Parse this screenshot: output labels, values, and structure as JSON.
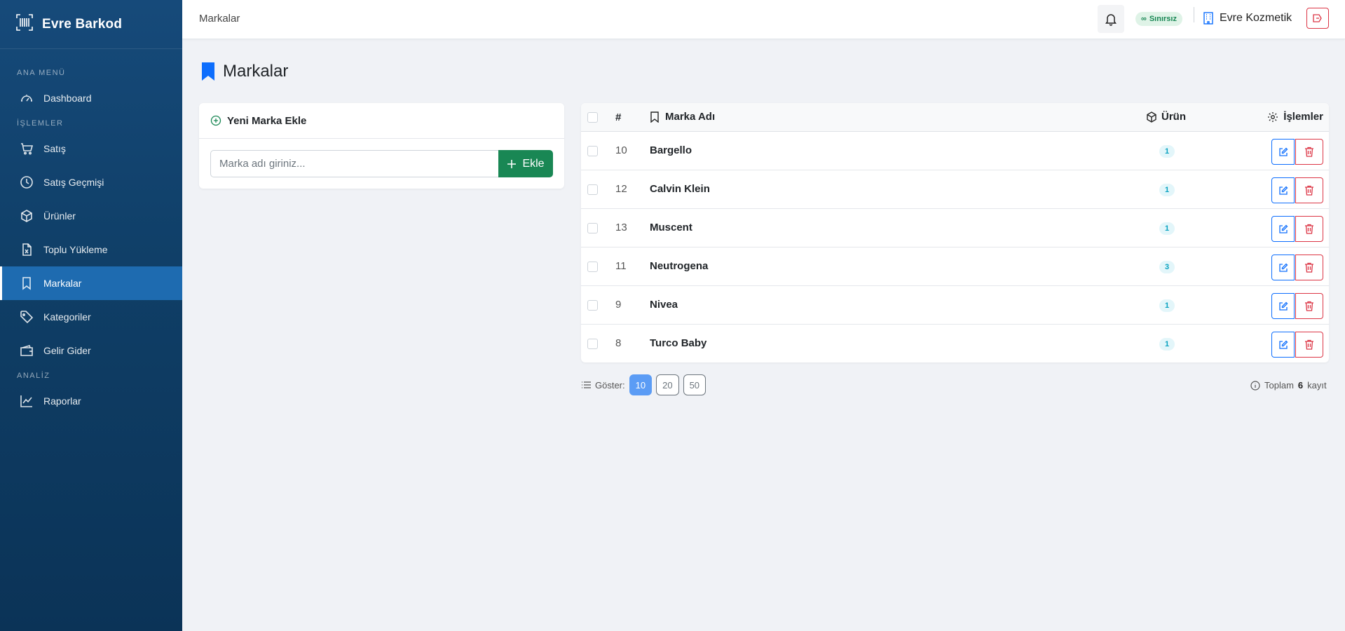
{
  "sidebar": {
    "brand": "Evre Barkod",
    "sections": {
      "main": "ANA MENÜ",
      "ops": "İŞLEMLER",
      "analysis": "ANALİZ"
    },
    "items": [
      {
        "label": "Dashboard",
        "icon": "gauge-icon"
      },
      {
        "label": "Satış",
        "icon": "cart-icon"
      },
      {
        "label": "Satış Geçmişi",
        "icon": "clock-icon"
      },
      {
        "label": "Ürünler",
        "icon": "box-icon"
      },
      {
        "label": "Toplu Yükleme",
        "icon": "excel-file-icon"
      },
      {
        "label": "Markalar",
        "icon": "bookmark-icon",
        "active": true
      },
      {
        "label": "Kategoriler",
        "icon": "tag-icon"
      },
      {
        "label": "Gelir Gider",
        "icon": "wallet-icon"
      },
      {
        "label": "Raporlar",
        "icon": "chart-line-icon"
      }
    ]
  },
  "topbar": {
    "title": "Markalar",
    "plan_badge": "Sınırsız",
    "company": "Evre Kozmetik"
  },
  "page": {
    "title": "Markalar"
  },
  "add_form": {
    "header": "Yeni Marka Ekle",
    "placeholder": "Marka adı giriniz...",
    "button": "Ekle"
  },
  "table": {
    "headers": {
      "num": "#",
      "name": "Marka Adı",
      "products": "Ürün",
      "actions": "İşlemler"
    },
    "rows": [
      {
        "id": "10",
        "name": "Bargello",
        "count": "1"
      },
      {
        "id": "12",
        "name": "Calvin Klein",
        "count": "1"
      },
      {
        "id": "13",
        "name": "Muscent",
        "count": "1"
      },
      {
        "id": "11",
        "name": "Neutrogena",
        "count": "3"
      },
      {
        "id": "9",
        "name": "Nivea",
        "count": "1"
      },
      {
        "id": "8",
        "name": "Turco Baby",
        "count": "1"
      }
    ]
  },
  "pagination": {
    "show_label": "Göster:",
    "sizes": [
      "10",
      "20",
      "50"
    ],
    "active_size": "10",
    "total_prefix": "Toplam",
    "total_count": "6",
    "total_suffix": "kayıt"
  },
  "colors": {
    "sidebar": "#0f3e66",
    "active": "#1e6bb0",
    "success": "#198754",
    "primary": "#0d6efd",
    "danger": "#dc3545"
  }
}
